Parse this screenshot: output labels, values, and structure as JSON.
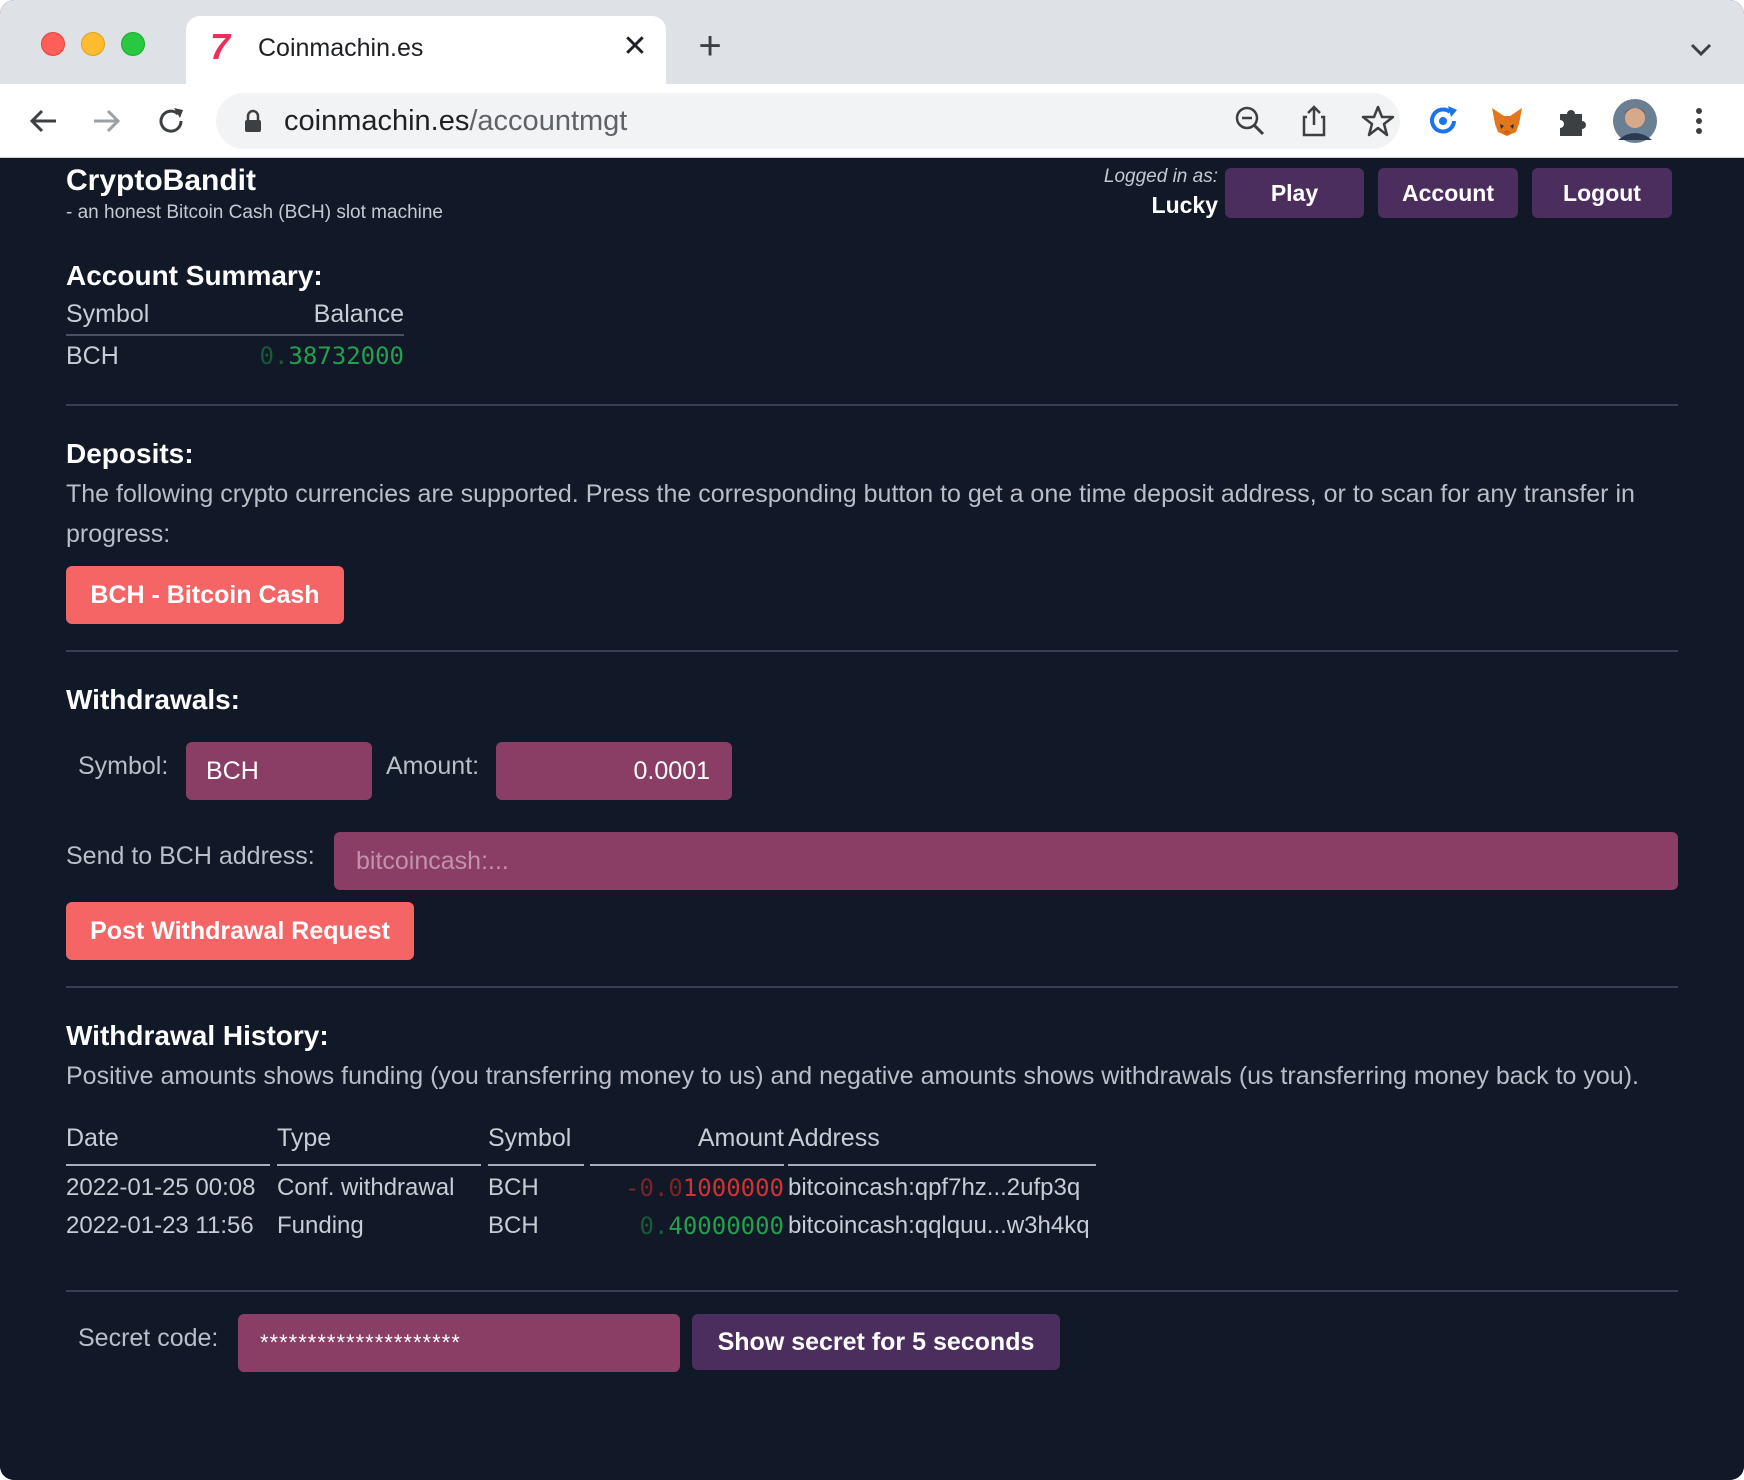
{
  "browser": {
    "tab_title": "Coinmachin.es",
    "favicon": "7",
    "url_host": "coinmachin.es",
    "url_path": "/accountmgt"
  },
  "header": {
    "brand": "CryptoBandit",
    "tagline": "- an honest Bitcoin Cash (BCH) slot machine",
    "logged_in_label": "Logged in as:",
    "username": "Lucky",
    "nav": {
      "play": "Play",
      "account": "Account",
      "logout": "Logout"
    }
  },
  "summary": {
    "title": "Account Summary:",
    "col_symbol": "Symbol",
    "col_balance": "Balance",
    "rows": [
      {
        "symbol": "BCH",
        "balance_dim": "0.",
        "balance_main": "38732000"
      }
    ]
  },
  "deposits": {
    "title": "Deposits:",
    "description": "The following crypto currencies are supported. Press the corresponding button to get a one time deposit address, or to scan for any transfer in progress:",
    "button": "BCH - Bitcoin Cash"
  },
  "withdrawals": {
    "title": "Withdrawals:",
    "symbol_label": "Symbol:",
    "symbol_value": "BCH",
    "amount_label": "Amount:",
    "amount_value": "0.0001",
    "address_label": "Send to BCH address:",
    "address_placeholder": "bitcoincash:...",
    "submit": "Post Withdrawal Request"
  },
  "history": {
    "title": "Withdrawal History:",
    "description": "Positive amounts shows funding (you transferring money to us) and negative amounts shows withdrawals (us transferring money back to you).",
    "columns": [
      "Date",
      "Type",
      "Symbol",
      "Amount",
      "Address"
    ],
    "rows": [
      {
        "date": "2022-01-25 00:08",
        "type": "Conf. withdrawal",
        "symbol": "BCH",
        "amount_dim": "-0.0",
        "amount_main": "1000000",
        "address": "bitcoincash:qpf7hz...2ufp3q"
      },
      {
        "date": "2022-01-23 11:56",
        "type": "Funding",
        "symbol": "BCH",
        "amount_dim": "0.",
        "amount_main": "40000000",
        "address": "bitcoincash:qqlquu...w3h4kq"
      }
    ]
  },
  "secret": {
    "label": "Secret code:",
    "value": "*********************",
    "button": "Show secret for 5 seconds"
  },
  "colors": {
    "page_bg": "#111827",
    "accent_red": "#f56565",
    "nav_purple": "#4c2e5e",
    "field_pink": "#8a3e66",
    "positive_green": "#22a04b",
    "negative_red": "#d13232"
  }
}
